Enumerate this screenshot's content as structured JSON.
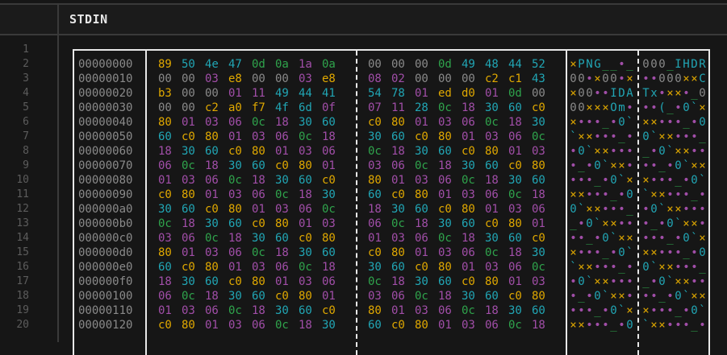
{
  "header": {
    "title": "STDIN"
  },
  "line_numbers": [
    "1",
    "2",
    "3",
    "4",
    "5",
    "6",
    "7",
    "8",
    "9",
    "10",
    "11",
    "12",
    "13",
    "14",
    "15",
    "16",
    "17",
    "18",
    "19",
    "20"
  ],
  "hex_rows": [
    {
      "offset": "00000000",
      "bytes": [
        "89",
        "50",
        "4e",
        "47",
        "0d",
        "0a",
        "1a",
        "0a",
        "00",
        "00",
        "00",
        "0d",
        "49",
        "48",
        "44",
        "52"
      ],
      "ascii": "×PNG__•_000_IHDR"
    },
    {
      "offset": "00000010",
      "bytes": [
        "00",
        "00",
        "03",
        "e8",
        "00",
        "00",
        "03",
        "e8",
        "08",
        "02",
        "00",
        "00",
        "00",
        "c2",
        "c1",
        "43"
      ],
      "ascii": "00•×00•×••000××C"
    },
    {
      "offset": "00000020",
      "bytes": [
        "b3",
        "00",
        "00",
        "01",
        "11",
        "49",
        "44",
        "41",
        "54",
        "78",
        "01",
        "ed",
        "d0",
        "01",
        "0d",
        "00"
      ],
      "ascii": "×00••IDATx•××•_0"
    },
    {
      "offset": "00000030",
      "bytes": [
        "00",
        "00",
        "c2",
        "a0",
        "f7",
        "4f",
        "6d",
        "0f",
        "07",
        "11",
        "28",
        "0c",
        "18",
        "30",
        "60",
        "c0"
      ],
      "ascii": "00×××Om•••(_•0`×"
    },
    {
      "offset": "00000040",
      "bytes": [
        "80",
        "01",
        "03",
        "06",
        "0c",
        "18",
        "30",
        "60",
        "c0",
        "80",
        "01",
        "03",
        "06",
        "0c",
        "18",
        "30"
      ],
      "ascii": "×•••_•0`××•••_•0"
    },
    {
      "offset": "00000050",
      "bytes": [
        "60",
        "c0",
        "80",
        "01",
        "03",
        "06",
        "0c",
        "18",
        "30",
        "60",
        "c0",
        "80",
        "01",
        "03",
        "06",
        "0c"
      ],
      "ascii": "`××•••_•0`××•••_"
    },
    {
      "offset": "00000060",
      "bytes": [
        "18",
        "30",
        "60",
        "c0",
        "80",
        "01",
        "03",
        "06",
        "0c",
        "18",
        "30",
        "60",
        "c0",
        "80",
        "01",
        "03"
      ],
      "ascii": "•0`××•••_•0`××••"
    },
    {
      "offset": "00000070",
      "bytes": [
        "06",
        "0c",
        "18",
        "30",
        "60",
        "c0",
        "80",
        "01",
        "03",
        "06",
        "0c",
        "18",
        "30",
        "60",
        "c0",
        "80"
      ],
      "ascii": "•_•0`××•••_•0`××"
    },
    {
      "offset": "00000080",
      "bytes": [
        "01",
        "03",
        "06",
        "0c",
        "18",
        "30",
        "60",
        "c0",
        "80",
        "01",
        "03",
        "06",
        "0c",
        "18",
        "30",
        "60"
      ],
      "ascii": "•••_•0`××•••_•0`"
    },
    {
      "offset": "00000090",
      "bytes": [
        "c0",
        "80",
        "01",
        "03",
        "06",
        "0c",
        "18",
        "30",
        "60",
        "c0",
        "80",
        "01",
        "03",
        "06",
        "0c",
        "18"
      ],
      "ascii": "××•••_•0`××•••_•"
    },
    {
      "offset": "000000a0",
      "bytes": [
        "30",
        "60",
        "c0",
        "80",
        "01",
        "03",
        "06",
        "0c",
        "18",
        "30",
        "60",
        "c0",
        "80",
        "01",
        "03",
        "06"
      ],
      "ascii": "0`××•••_•0`××•••"
    },
    {
      "offset": "000000b0",
      "bytes": [
        "0c",
        "18",
        "30",
        "60",
        "c0",
        "80",
        "01",
        "03",
        "06",
        "0c",
        "18",
        "30",
        "60",
        "c0",
        "80",
        "01"
      ],
      "ascii": "_•0`××•••_•0`××•"
    },
    {
      "offset": "000000c0",
      "bytes": [
        "03",
        "06",
        "0c",
        "18",
        "30",
        "60",
        "c0",
        "80",
        "01",
        "03",
        "06",
        "0c",
        "18",
        "30",
        "60",
        "c0"
      ],
      "ascii": "••_•0`××•••_•0`×"
    },
    {
      "offset": "000000d0",
      "bytes": [
        "80",
        "01",
        "03",
        "06",
        "0c",
        "18",
        "30",
        "60",
        "c0",
        "80",
        "01",
        "03",
        "06",
        "0c",
        "18",
        "30"
      ],
      "ascii": "×•••_•0`××•••_•0"
    },
    {
      "offset": "000000e0",
      "bytes": [
        "60",
        "c0",
        "80",
        "01",
        "03",
        "06",
        "0c",
        "18",
        "30",
        "60",
        "c0",
        "80",
        "01",
        "03",
        "06",
        "0c"
      ],
      "ascii": "`××•••_•0`××•••_"
    },
    {
      "offset": "000000f0",
      "bytes": [
        "18",
        "30",
        "60",
        "c0",
        "80",
        "01",
        "03",
        "06",
        "0c",
        "18",
        "30",
        "60",
        "c0",
        "80",
        "01",
        "03"
      ],
      "ascii": "•0`××•••_•0`××••"
    },
    {
      "offset": "00000100",
      "bytes": [
        "06",
        "0c",
        "18",
        "30",
        "60",
        "c0",
        "80",
        "01",
        "03",
        "06",
        "0c",
        "18",
        "30",
        "60",
        "c0",
        "80"
      ],
      "ascii": "•_•0`××•••_•0`××"
    },
    {
      "offset": "00000110",
      "bytes": [
        "01",
        "03",
        "06",
        "0c",
        "18",
        "30",
        "60",
        "c0",
        "80",
        "01",
        "03",
        "06",
        "0c",
        "18",
        "30",
        "60"
      ],
      "ascii": "•••_•0`××•••_•0`"
    },
    {
      "offset": "00000120",
      "bytes": [
        "c0",
        "80",
        "01",
        "03",
        "06",
        "0c",
        "18",
        "30",
        "60",
        "c0",
        "80",
        "01",
        "03",
        "06",
        "0c",
        "18"
      ],
      "ascii": "××•••_•0`××•••_•"
    }
  ],
  "colors": {
    "background": "#161616",
    "border": "#e8e8e8",
    "offset": "#8a8a8a",
    "null": "#8a8a8a",
    "printable": "#21a6b5",
    "whitespace": "#2fa44c",
    "control": "#a14ea8",
    "high": "#e0a800"
  }
}
